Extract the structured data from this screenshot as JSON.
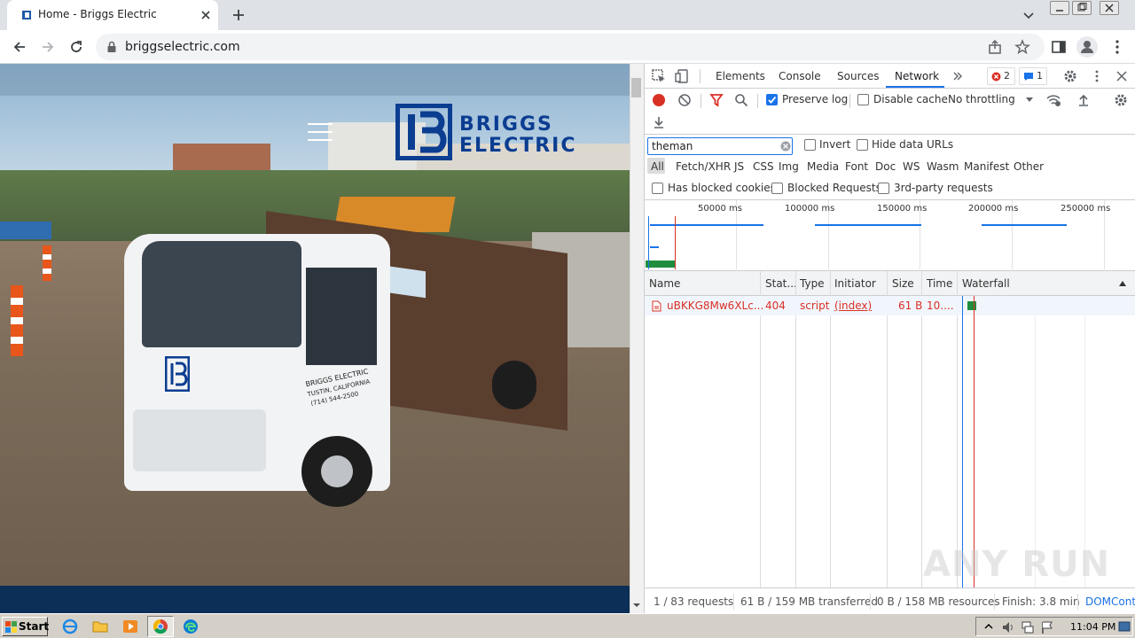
{
  "browser": {
    "tab_title": "Home - Briggs Electric",
    "url": "briggselectric.com"
  },
  "site": {
    "logo_line1": "BRIGGS",
    "logo_line2": "ELECTRIC",
    "truck_text_line1": "BRIGGS ELECTRIC",
    "truck_text_line2": "TUSTIN, CALIFORNIA",
    "truck_text_line3": "(714) 544-2500"
  },
  "devtools": {
    "tabs": [
      "Elements",
      "Console",
      "Sources",
      "Network"
    ],
    "active_tab": "Network",
    "error_count": "2",
    "message_count": "1",
    "toolbar": {
      "preserve_log": "Preserve log",
      "disable_cache": "Disable cache",
      "throttling": "No throttling"
    },
    "filter": {
      "value": "theman",
      "invert": "Invert",
      "hide_data_urls": "Hide data URLs",
      "types": [
        "All",
        "Fetch/XHR",
        "JS",
        "CSS",
        "Img",
        "Media",
        "Font",
        "Doc",
        "WS",
        "Wasm",
        "Manifest",
        "Other"
      ],
      "has_blocked_cookies": "Has blocked cookies",
      "blocked_requests": "Blocked Requests",
      "third_party": "3rd-party requests"
    },
    "overview_labels": [
      "50000 ms",
      "100000 ms",
      "150000 ms",
      "200000 ms",
      "250000 ms"
    ],
    "columns": [
      "Name",
      "Stat...",
      "Type",
      "Initiator",
      "Size",
      "Time",
      "Waterfall"
    ],
    "requests": [
      {
        "name": "uBKKG8Mw6XLc...",
        "status": "404",
        "type": "script",
        "initiator": "(index)",
        "size": "61 B",
        "time": "10...."
      }
    ],
    "status": {
      "requests": "1 / 83 requests",
      "transferred": "61 B / 159 MB transferred",
      "resources": "0 B / 158 MB resources",
      "finish": "Finish: 3.8 min",
      "domcontent": "DOMCont"
    }
  },
  "taskbar": {
    "start": "Start",
    "clock": "11:04 PM"
  },
  "watermark": "ANY RUN",
  "colors": {
    "accent": "#1a73e8",
    "error": "#d93025",
    "brand_blue": "#0b3d91"
  }
}
